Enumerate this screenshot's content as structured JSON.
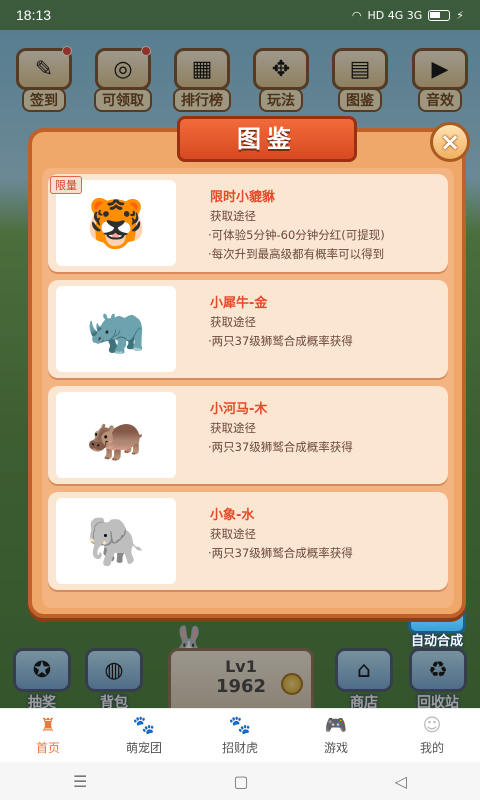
{
  "status": {
    "time": "18:13",
    "signal": "HD 4G 3G"
  },
  "top_buttons": [
    {
      "label": "签到",
      "icon": "pencil-icon",
      "glyph": "✎",
      "dot": true
    },
    {
      "label": "可领取",
      "icon": "coin-stack-icon",
      "glyph": "◎",
      "dot": true
    },
    {
      "label": "排行榜",
      "icon": "podium-icon",
      "glyph": "▦",
      "dot": false
    },
    {
      "label": "玩法",
      "icon": "pinwheel-icon",
      "glyph": "✥",
      "dot": false
    },
    {
      "label": "图鉴",
      "icon": "book-icon",
      "glyph": "▤",
      "dot": false
    },
    {
      "label": "音效",
      "icon": "play-icon",
      "glyph": "▶",
      "dot": false
    }
  ],
  "dialog": {
    "title": "图鉴",
    "close_label": "×",
    "cards": [
      {
        "tag": "限量",
        "name": "限时小貔貅",
        "way": "获取途径",
        "lines": [
          "·可体验5分钟-60分钟分红(可提现)",
          "·每次升到最高级都有概率可以得到"
        ],
        "icon": "tiger-icon",
        "glyph": "🐯"
      },
      {
        "tag": "",
        "name": "小犀牛-金",
        "way": "获取途径",
        "lines": [
          "·两只37级狮鹫合成概率获得"
        ],
        "icon": "rhino-icon",
        "glyph": "🦏"
      },
      {
        "tag": "",
        "name": "小河马-木",
        "way": "获取途径",
        "lines": [
          "·两只37级狮鹫合成概率获得"
        ],
        "icon": "hippo-icon",
        "glyph": "🦛"
      },
      {
        "tag": "",
        "name": "小象-水",
        "way": "获取途径",
        "lines": [
          "·两只37级狮鹫合成概率获得"
        ],
        "icon": "elephant-icon",
        "glyph": "🐘"
      }
    ]
  },
  "auto_merge": {
    "label": "自动合成",
    "icon": "cassette-icon",
    "glyph": "▣"
  },
  "bottom_buttons": [
    {
      "label": "抽奖",
      "icon": "wheel-icon",
      "glyph": "✪"
    },
    {
      "label": "背包",
      "icon": "bag-icon",
      "glyph": "◍"
    },
    {
      "label": "商店",
      "icon": "shop-icon",
      "glyph": "⌂"
    },
    {
      "label": "回收站",
      "icon": "recycle-icon",
      "glyph": "♻"
    }
  ],
  "level": {
    "lv": "Lv1",
    "score": "1962"
  },
  "nav": [
    {
      "label": "首页",
      "icon": "castle-icon",
      "glyph": "♜",
      "active": true
    },
    {
      "label": "萌宠团",
      "icon": "paw-icon",
      "glyph": "🐾",
      "active": false
    },
    {
      "label": "招财虎",
      "icon": "paw-icon",
      "glyph": "🐾",
      "active": false
    },
    {
      "label": "游戏",
      "icon": "gamepad-icon",
      "glyph": "🎮",
      "active": false
    },
    {
      "label": "我的",
      "icon": "profile-icon",
      "glyph": "☺",
      "active": false
    }
  ],
  "system_nav": {
    "menu": "☰",
    "home": "▢",
    "back": "◁"
  }
}
